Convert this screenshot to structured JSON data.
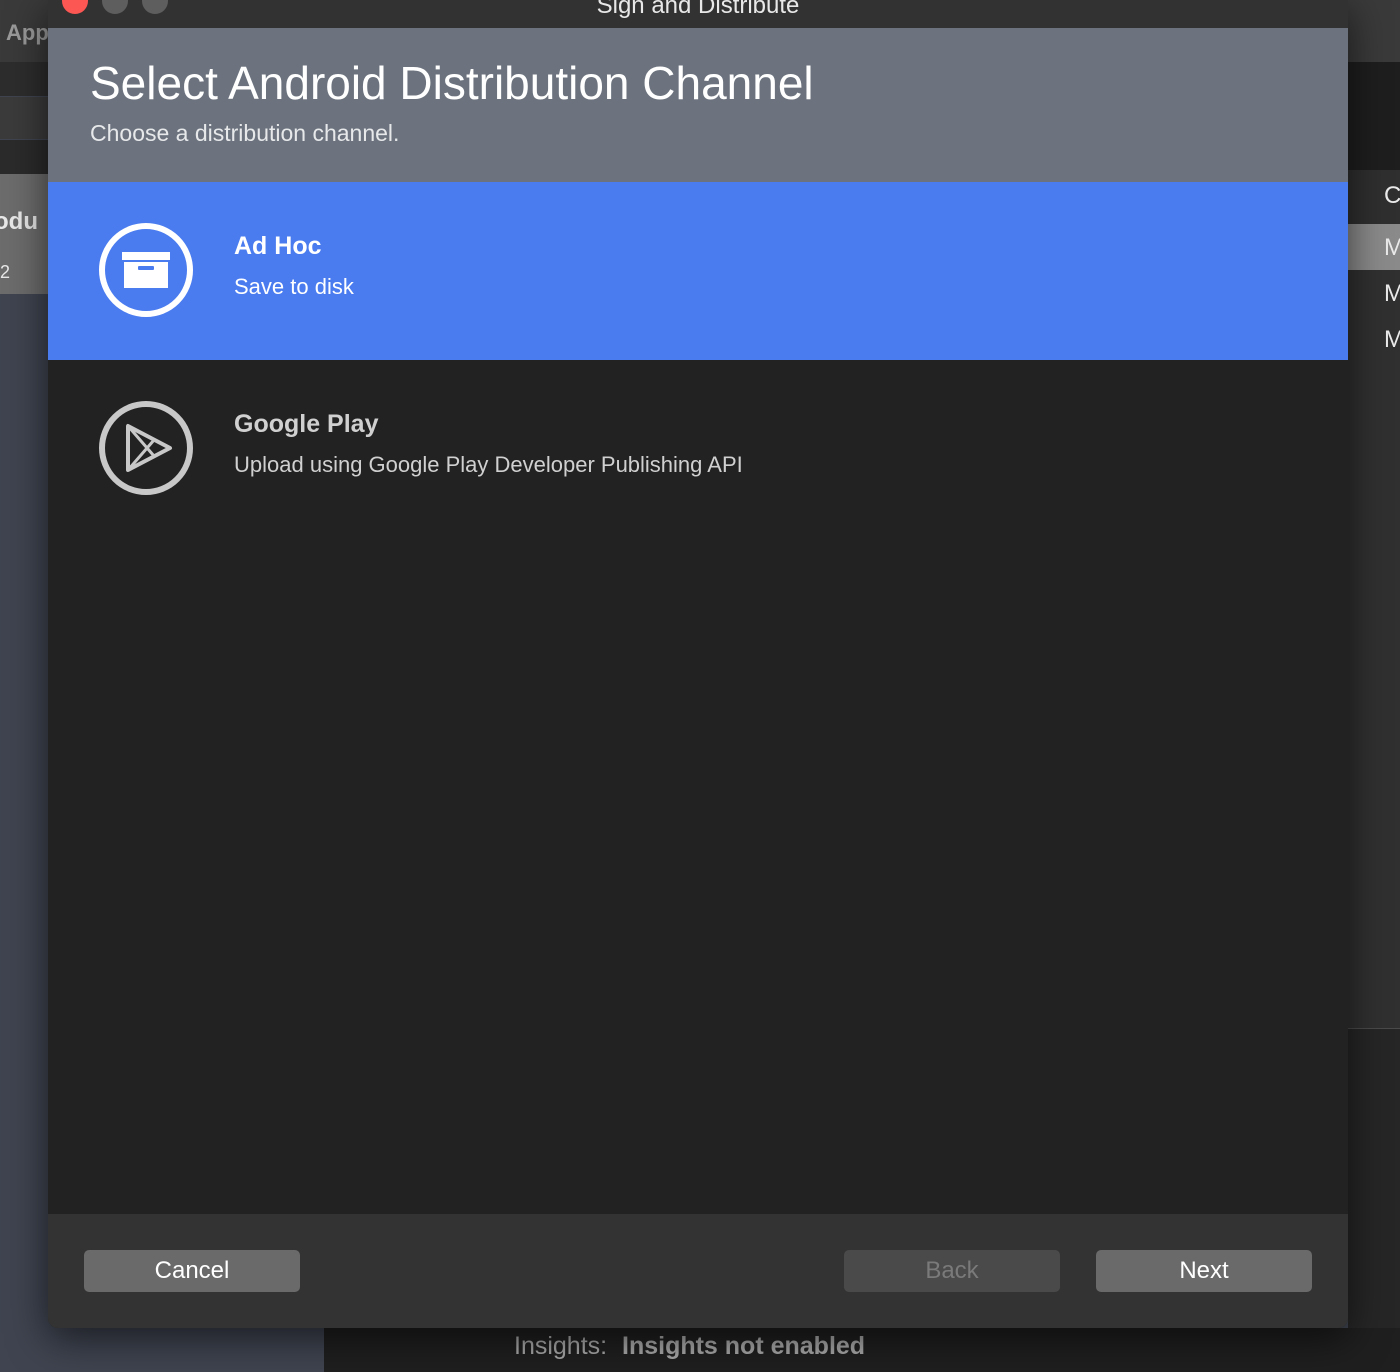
{
  "window": {
    "title": "Sign and Distribute"
  },
  "background": {
    "left_tab_label": "App",
    "left_item_title": "odu",
    "left_item_sub": "2",
    "right_header_letter": "C",
    "right_rows": [
      "M",
      "M",
      "M"
    ],
    "status_key": "Insights:",
    "status_value": "Insights not enabled"
  },
  "header": {
    "title": "Select Android Distribution Channel",
    "subtitle": "Choose a distribution channel."
  },
  "channels": [
    {
      "name": "Ad Hoc",
      "description": "Save to disk",
      "icon": "archive-box-icon",
      "selected": true
    },
    {
      "name": "Google Play",
      "description": "Upload using Google Play Developer Publishing API",
      "icon": "play-store-icon",
      "selected": false
    }
  ],
  "footer": {
    "cancel_label": "Cancel",
    "back_label": "Back",
    "next_label": "Next",
    "back_enabled": false
  },
  "colors": {
    "selected_row": "#4a7cf0",
    "header_bg": "#6c737e",
    "dialog_bg": "#222222",
    "close_button": "#fc5753"
  }
}
